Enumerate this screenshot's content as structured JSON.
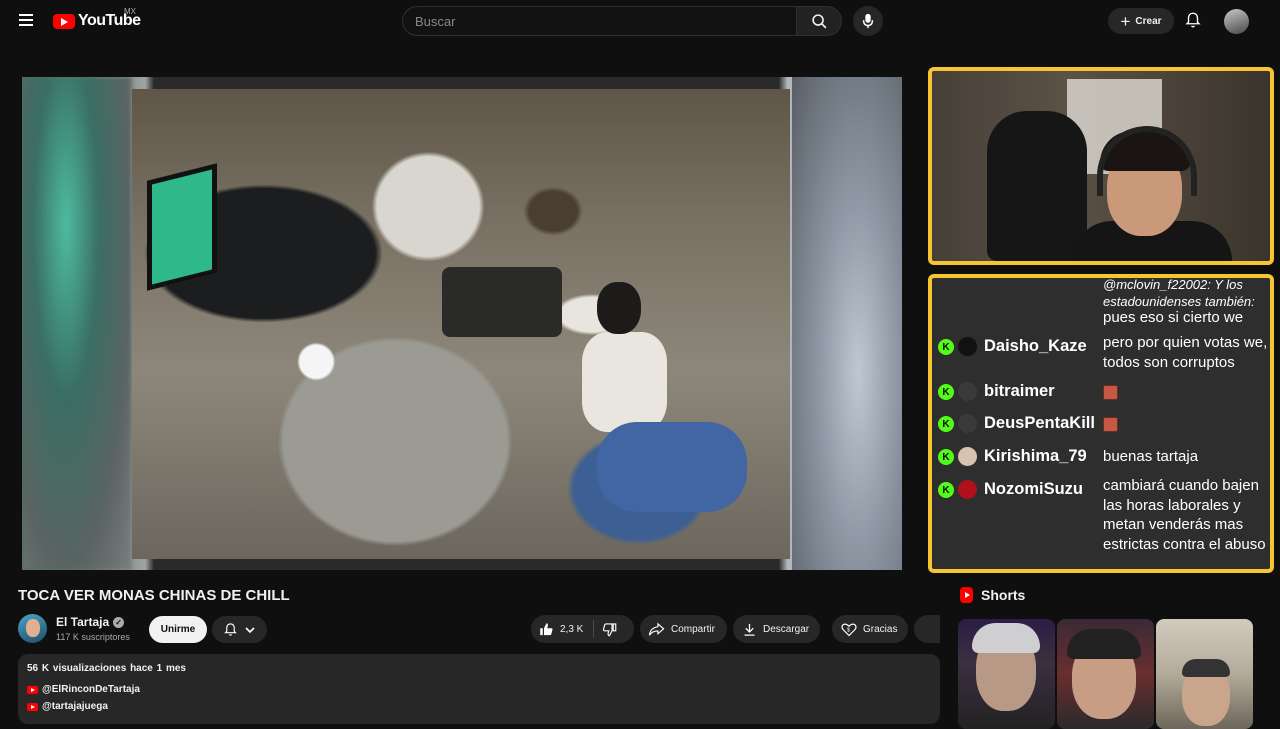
{
  "header": {
    "logo_text": "YouTube",
    "region": "MX",
    "search_placeholder": "Buscar",
    "create_label": "Crear"
  },
  "video": {
    "title": "TOCA VER MONAS CHINAS DE CHILL"
  },
  "channel": {
    "name": "El Tartaja",
    "subscribers": "117 K suscriptores",
    "join_label": "Unirme"
  },
  "actions": {
    "likes": "2,3 K",
    "share_label": "Compartir",
    "download_label": "Descargar",
    "thanks_label": "Gracias"
  },
  "description": {
    "views": "56 K visualizaciones",
    "time": "hace 1 mes",
    "links": [
      "@ElRinconDeTartaja",
      "@tartajajuega"
    ]
  },
  "chat": {
    "messages": [
      {
        "user": "",
        "text": "@mclovin_f22002: Y los estadounidenses también:",
        "top": 0
      },
      {
        "user": "",
        "text": "pues eso si cierto we",
        "top": 0
      },
      {
        "user": "Daisho_Kaze",
        "text": "pero por quien votas we, todos son corruptos"
      },
      {
        "user": "bitraimer",
        "text": ""
      },
      {
        "user": "DeusPentaKill",
        "text": ""
      },
      {
        "user": "Kirishima_79",
        "text": "buenas tartaja"
      },
      {
        "user": "NozomiSuzu",
        "text": "cambiará cuando bajen las horas laborales y metan venderás mas estrictas contra el abuso"
      }
    ],
    "badge_letter": "K"
  },
  "shorts": {
    "heading": "Shorts"
  },
  "colors": {
    "accent_border": "#f7c531",
    "kick_green": "#53fc18",
    "youtube_red": "#ff0000"
  }
}
